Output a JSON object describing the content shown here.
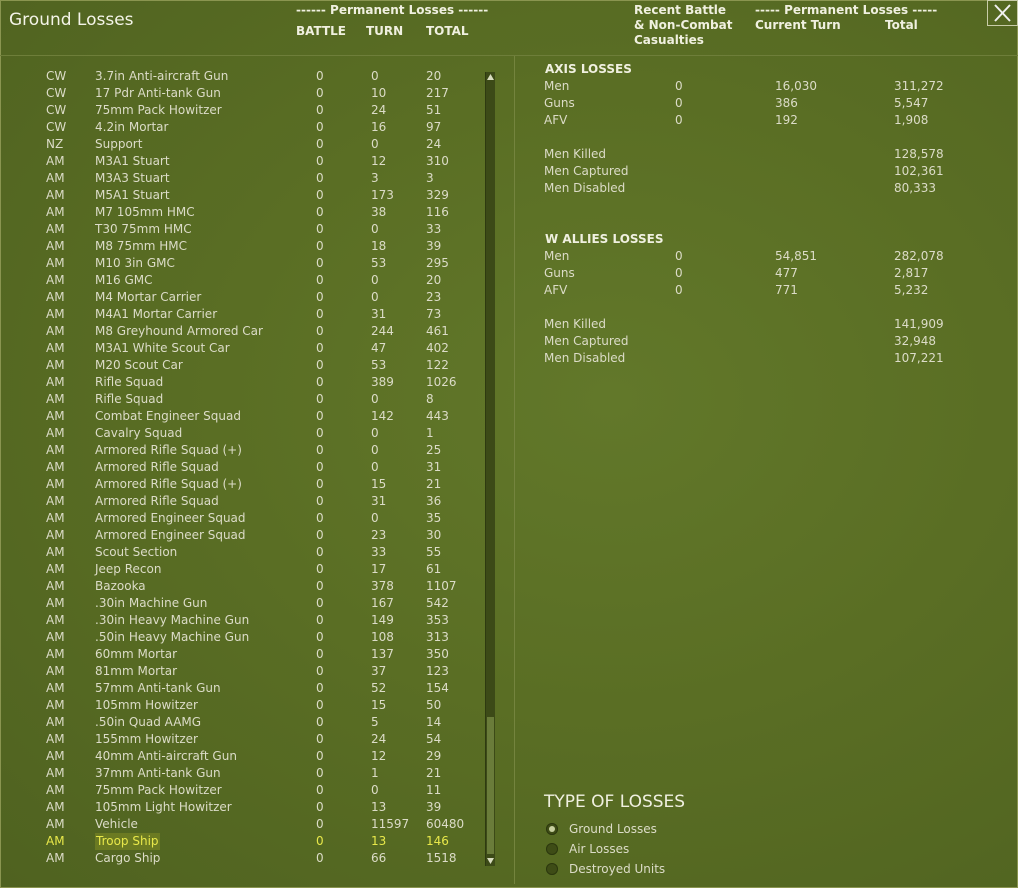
{
  "window": {
    "title": "Ground Losses"
  },
  "list_header": {
    "group_label": "------ Permanent Losses ------",
    "col_battle": "BATTLE",
    "col_turn": "TURN",
    "col_total": "TOTAL"
  },
  "summary_header": {
    "recent_line1": "Recent Battle",
    "recent_line2": "& Non-Combat",
    "recent_line3": "Casualties",
    "perm_label": "----- Permanent Losses -----",
    "col_current_turn": "Current Turn",
    "col_total": "Total"
  },
  "rows": [
    {
      "nat": "CW",
      "name": "3.7in Anti-aircraft Gun",
      "battle": "0",
      "turn": "0",
      "total": "20"
    },
    {
      "nat": "CW",
      "name": "17 Pdr Anti-tank Gun",
      "battle": "0",
      "turn": "10",
      "total": "217"
    },
    {
      "nat": "CW",
      "name": "75mm Pack Howitzer",
      "battle": "0",
      "turn": "24",
      "total": "51"
    },
    {
      "nat": "CW",
      "name": "4.2in Mortar",
      "battle": "0",
      "turn": "16",
      "total": "97"
    },
    {
      "nat": "NZ",
      "name": "Support",
      "battle": "0",
      "turn": "0",
      "total": "24"
    },
    {
      "nat": "AM",
      "name": "M3A1 Stuart",
      "battle": "0",
      "turn": "12",
      "total": "310"
    },
    {
      "nat": "AM",
      "name": "M3A3 Stuart",
      "battle": "0",
      "turn": "3",
      "total": "3"
    },
    {
      "nat": "AM",
      "name": "M5A1 Stuart",
      "battle": "0",
      "turn": "173",
      "total": "329"
    },
    {
      "nat": "AM",
      "name": "M7 105mm HMC",
      "battle": "0",
      "turn": "38",
      "total": "116"
    },
    {
      "nat": "AM",
      "name": "T30 75mm HMC",
      "battle": "0",
      "turn": "0",
      "total": "33"
    },
    {
      "nat": "AM",
      "name": "M8 75mm HMC",
      "battle": "0",
      "turn": "18",
      "total": "39"
    },
    {
      "nat": "AM",
      "name": "M10 3in GMC",
      "battle": "0",
      "turn": "53",
      "total": "295"
    },
    {
      "nat": "AM",
      "name": "M16 GMC",
      "battle": "0",
      "turn": "0",
      "total": "20"
    },
    {
      "nat": "AM",
      "name": "M4 Mortar Carrier",
      "battle": "0",
      "turn": "0",
      "total": "23"
    },
    {
      "nat": "AM",
      "name": "M4A1 Mortar Carrier",
      "battle": "0",
      "turn": "31",
      "total": "73"
    },
    {
      "nat": "AM",
      "name": "M8 Greyhound Armored Car",
      "battle": "0",
      "turn": "244",
      "total": "461"
    },
    {
      "nat": "AM",
      "name": "M3A1 White Scout Car",
      "battle": "0",
      "turn": "47",
      "total": "402"
    },
    {
      "nat": "AM",
      "name": "M20 Scout Car",
      "battle": "0",
      "turn": "53",
      "total": "122"
    },
    {
      "nat": "AM",
      "name": "Rifle Squad",
      "battle": "0",
      "turn": "389",
      "total": "1026"
    },
    {
      "nat": "AM",
      "name": "Rifle Squad",
      "battle": "0",
      "turn": "0",
      "total": "8"
    },
    {
      "nat": "AM",
      "name": "Combat Engineer Squad",
      "battle": "0",
      "turn": "142",
      "total": "443"
    },
    {
      "nat": "AM",
      "name": "Cavalry Squad",
      "battle": "0",
      "turn": "0",
      "total": "1"
    },
    {
      "nat": "AM",
      "name": "Armored Rifle Squad (+)",
      "battle": "0",
      "turn": "0",
      "total": "25"
    },
    {
      "nat": "AM",
      "name": "Armored Rifle Squad",
      "battle": "0",
      "turn": "0",
      "total": "31"
    },
    {
      "nat": "AM",
      "name": "Armored Rifle Squad (+)",
      "battle": "0",
      "turn": "15",
      "total": "21"
    },
    {
      "nat": "AM",
      "name": "Armored Rifle Squad",
      "battle": "0",
      "turn": "31",
      "total": "36"
    },
    {
      "nat": "AM",
      "name": "Armored Engineer Squad",
      "battle": "0",
      "turn": "0",
      "total": "35"
    },
    {
      "nat": "AM",
      "name": "Armored Engineer Squad",
      "battle": "0",
      "turn": "23",
      "total": "30"
    },
    {
      "nat": "AM",
      "name": "Scout Section",
      "battle": "0",
      "turn": "33",
      "total": "55"
    },
    {
      "nat": "AM",
      "name": "Jeep Recon",
      "battle": "0",
      "turn": "17",
      "total": "61"
    },
    {
      "nat": "AM",
      "name": "Bazooka",
      "battle": "0",
      "turn": "378",
      "total": "1107"
    },
    {
      "nat": "AM",
      "name": ".30in Machine Gun",
      "battle": "0",
      "turn": "167",
      "total": "542"
    },
    {
      "nat": "AM",
      "name": ".30in Heavy Machine Gun",
      "battle": "0",
      "turn": "149",
      "total": "353"
    },
    {
      "nat": "AM",
      "name": ".50in Heavy Machine Gun",
      "battle": "0",
      "turn": "108",
      "total": "313"
    },
    {
      "nat": "AM",
      "name": "60mm Mortar",
      "battle": "0",
      "turn": "137",
      "total": "350"
    },
    {
      "nat": "AM",
      "name": "81mm Mortar",
      "battle": "0",
      "turn": "37",
      "total": "123"
    },
    {
      "nat": "AM",
      "name": "57mm Anti-tank Gun",
      "battle": "0",
      "turn": "52",
      "total": "154"
    },
    {
      "nat": "AM",
      "name": "105mm Howitzer",
      "battle": "0",
      "turn": "15",
      "total": "50"
    },
    {
      "nat": "AM",
      "name": ".50in Quad AAMG",
      "battle": "0",
      "turn": "5",
      "total": "14"
    },
    {
      "nat": "AM",
      "name": "155mm Howitzer",
      "battle": "0",
      "turn": "24",
      "total": "54"
    },
    {
      "nat": "AM",
      "name": "40mm Anti-aircraft Gun",
      "battle": "0",
      "turn": "12",
      "total": "29"
    },
    {
      "nat": "AM",
      "name": "37mm Anti-tank Gun",
      "battle": "0",
      "turn": "1",
      "total": "21"
    },
    {
      "nat": "AM",
      "name": "75mm Pack Howitzer",
      "battle": "0",
      "turn": "0",
      "total": "11"
    },
    {
      "nat": "AM",
      "name": "105mm Light Howitzer",
      "battle": "0",
      "turn": "13",
      "total": "39"
    },
    {
      "nat": "AM",
      "name": "Vehicle",
      "battle": "0",
      "turn": "11597",
      "total": "60480"
    },
    {
      "nat": "AM",
      "name": "Troop Ship",
      "battle": "0",
      "turn": "13",
      "total": "146",
      "highlighted": true
    },
    {
      "nat": "AM",
      "name": "Cargo Ship",
      "battle": "0",
      "turn": "66",
      "total": "1518"
    }
  ],
  "axis": {
    "title": "AXIS LOSSES",
    "men": {
      "label": "Men",
      "recent": "0",
      "turn": "16,030",
      "total": "311,272"
    },
    "guns": {
      "label": "Guns",
      "recent": "0",
      "turn": "386",
      "total": "5,547"
    },
    "afv": {
      "label": "AFV",
      "recent": "0",
      "turn": "192",
      "total": "1,908"
    },
    "killed": {
      "label": "Men Killed",
      "total": "128,578"
    },
    "captured": {
      "label": "Men Captured",
      "total": "102,361"
    },
    "disabled": {
      "label": "Men Disabled",
      "total": "80,333"
    }
  },
  "allies": {
    "title": "W ALLIES LOSSES",
    "men": {
      "label": "Men",
      "recent": "0",
      "turn": "54,851",
      "total": "282,078"
    },
    "guns": {
      "label": "Guns",
      "recent": "0",
      "turn": "477",
      "total": "2,817"
    },
    "afv": {
      "label": "AFV",
      "recent": "0",
      "turn": "771",
      "total": "5,232"
    },
    "killed": {
      "label": "Men Killed",
      "total": "141,909"
    },
    "captured": {
      "label": "Men Captured",
      "total": "32,948"
    },
    "disabled": {
      "label": "Men Disabled",
      "total": "107,221"
    }
  },
  "loss_types": {
    "title": "TYPE OF LOSSES",
    "options": [
      {
        "label": "Ground Losses",
        "selected": true
      },
      {
        "label": "Air Losses",
        "selected": false
      },
      {
        "label": "Destroyed Units",
        "selected": false
      }
    ]
  },
  "colors": {
    "background": "#5a6e24",
    "highlight_text": "#e8e84a",
    "text": "#dcdcc8"
  }
}
